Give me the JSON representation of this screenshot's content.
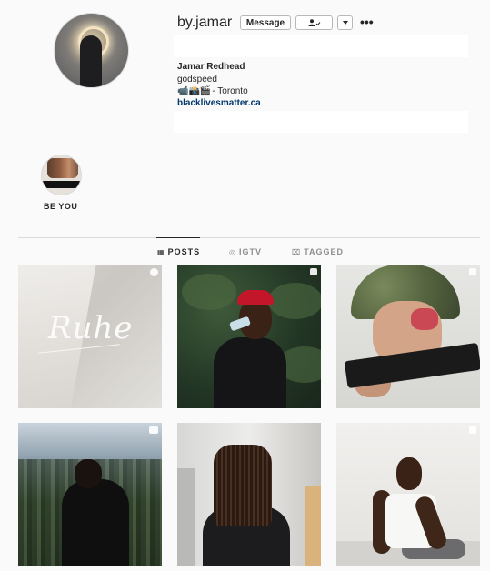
{
  "profile": {
    "username": "by.jamar",
    "message_label": "Message",
    "full_name": "Jamar Redhead",
    "bio_line1": "godspeed",
    "bio_emojis": "📹📸🎬",
    "bio_location": " - Toronto",
    "link": "blacklivesmatter.ca"
  },
  "icons": {
    "follow": "person-check-icon",
    "dropdown": "caret-down-icon",
    "more": "ellipsis-icon"
  },
  "more_glyph": "•••",
  "highlight": {
    "label": "BE YOU"
  },
  "tabs": [
    {
      "label": "POSTS",
      "icon": "grid-icon",
      "glyph": "▦",
      "active": true
    },
    {
      "label": "IGTV",
      "icon": "igtv-icon",
      "glyph": "◎",
      "active": false
    },
    {
      "label": "TAGGED",
      "icon": "tag-icon",
      "glyph": "⌧",
      "active": false
    }
  ],
  "posts": [
    {
      "caption_text": "Ruhe",
      "badge": "carousel"
    },
    {
      "caption_text": "",
      "badge": "carousel"
    },
    {
      "caption_text": "",
      "badge": "carousel"
    },
    {
      "caption_text": "",
      "badge": "igtv"
    },
    {
      "caption_text": "",
      "badge": "none"
    },
    {
      "caption_text": "",
      "badge": "carousel"
    }
  ],
  "colors": {
    "background": "#fafafa",
    "text": "#262626",
    "link": "#00376b",
    "border": "#dbdbdb",
    "muted": "#8e8e8e"
  }
}
